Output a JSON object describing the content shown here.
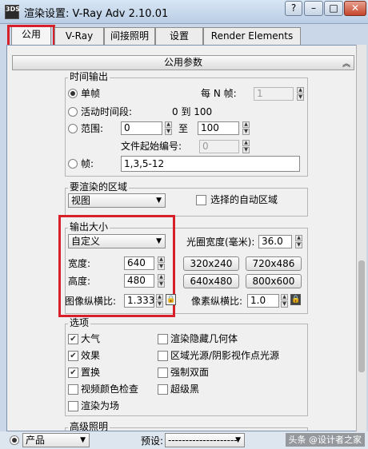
{
  "window": {
    "app_icon_text": "3DS",
    "title": "渲染设置: V-Ray Adv 2.10.01",
    "buttons": [
      "?",
      "–",
      "□",
      "✕"
    ]
  },
  "tabs": [
    {
      "label": "公用",
      "active": true
    },
    {
      "label": "V-Ray",
      "active": false
    },
    {
      "label": "间接照明",
      "active": false
    },
    {
      "label": "设置",
      "active": false
    },
    {
      "label": "Render Elements",
      "active": false
    }
  ],
  "rollout": {
    "title": "公用参数",
    "collapse_icon": "double-chevron-up-icon",
    "collapse_glyph": "︽"
  },
  "time_output": {
    "group_label": "时间输出",
    "single_frame": "单帧",
    "every_n_label": "每 N 帧:",
    "every_n_value": "1",
    "active_segment": "活动时间段:",
    "active_range_text": "0 到 100",
    "range_label": "范围:",
    "range_from": "0",
    "range_to_label": "至",
    "range_to": "100",
    "file_start_label": "文件起始编号:",
    "file_start_value": "0",
    "frames_label": "帧:",
    "frames_value": "1,3,5-12"
  },
  "area_to_render": {
    "group_label": "要渲染的区域",
    "selected": "视图",
    "auto_region_label": "选择的自动区域"
  },
  "output_size": {
    "group_label": "输出大小",
    "preset": "自定义",
    "aperture_label": "光圈宽度(毫米):",
    "aperture_value": "36.0",
    "width_label": "宽度:",
    "width_value": "640",
    "height_label": "高度:",
    "height_value": "480",
    "presets": [
      "320x240",
      "720x486",
      "640x480",
      "800x600"
    ],
    "image_aspect_label": "图像纵横比:",
    "image_aspect_value": "1.333",
    "pixel_aspect_label": "像素纵横比:",
    "pixel_aspect_value": "1.0",
    "highlight_color": "#d8202b"
  },
  "options": {
    "group_label": "选项",
    "left": [
      {
        "label": "大气",
        "checked": true
      },
      {
        "label": "效果",
        "checked": true
      },
      {
        "label": "置换",
        "checked": true
      },
      {
        "label": "视频颜色检查",
        "checked": false
      },
      {
        "label": "渲染为场",
        "checked": false
      }
    ],
    "right": [
      {
        "label": "渲染隐藏几何体",
        "checked": false
      },
      {
        "label": "区域光源/阴影视作点光源",
        "checked": false
      },
      {
        "label": "强制双面",
        "checked": false
      },
      {
        "label": "超级黑",
        "checked": false
      }
    ]
  },
  "advanced_lighting": {
    "group_label": "高级照明"
  },
  "bottom": {
    "mode_value": "产品",
    "preset_label": "预设:",
    "preset_value": "--------------------",
    "watermark": "头条 @设计者之家"
  }
}
